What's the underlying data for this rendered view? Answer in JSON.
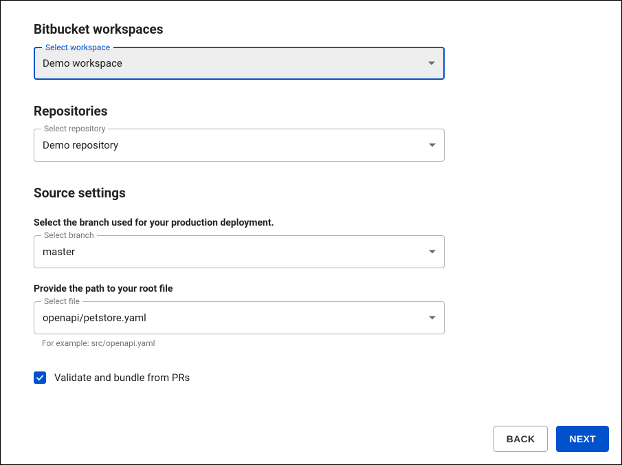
{
  "headings": {
    "workspaces": "Bitbucket workspaces",
    "repositories": "Repositories",
    "source": "Source settings"
  },
  "workspace": {
    "label": "Select workspace",
    "value": "Demo workspace"
  },
  "repository": {
    "label": "Select repository",
    "value": "Demo repository"
  },
  "branch": {
    "prompt": "Select the branch used for your production deployment.",
    "label": "Select branch",
    "value": "master"
  },
  "file": {
    "prompt": "Provide the path to your root file",
    "label": "Select file",
    "value": "openapi/petstore.yaml",
    "helper": "For example: src/openapi.yaml"
  },
  "validate": {
    "label": "Validate and bundle from PRs",
    "checked": true
  },
  "buttons": {
    "back": "BACK",
    "next": "NEXT"
  },
  "colors": {
    "primary": "#0052cc"
  }
}
